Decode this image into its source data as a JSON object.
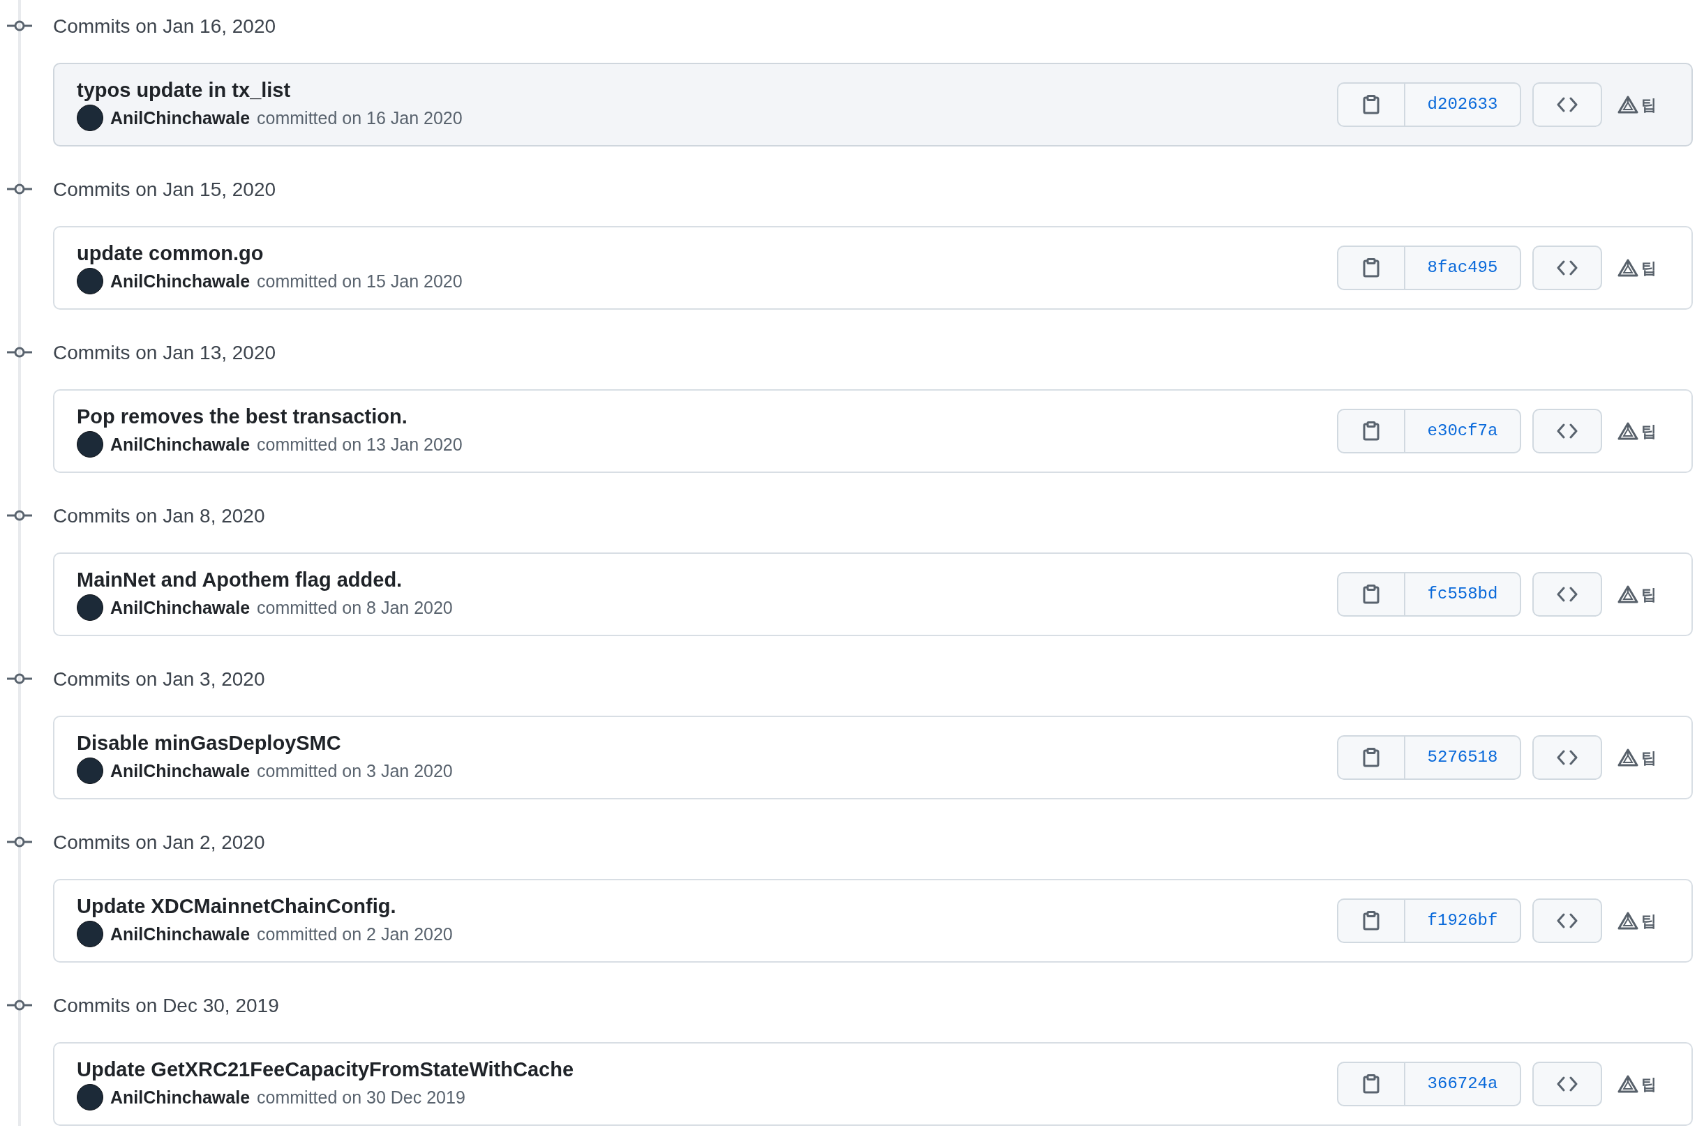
{
  "groups": [
    {
      "heading": "Commits on Jan 16, 2020",
      "commits": [
        {
          "message": "typos update in tx_list",
          "author": "AnilChinchawale",
          "meta": "committed on 16 Jan 2020",
          "sha": "d202633",
          "extra": "팁",
          "highlighted": true
        }
      ]
    },
    {
      "heading": "Commits on Jan 15, 2020",
      "commits": [
        {
          "message": "update common.go",
          "author": "AnilChinchawale",
          "meta": "committed on 15 Jan 2020",
          "sha": "8fac495",
          "extra": "팁",
          "highlighted": false
        }
      ]
    },
    {
      "heading": "Commits on Jan 13, 2020",
      "commits": [
        {
          "message": "Pop removes the best transaction.",
          "author": "AnilChinchawale",
          "meta": "committed on 13 Jan 2020",
          "sha": "e30cf7a",
          "extra": "팁",
          "highlighted": false
        }
      ]
    },
    {
      "heading": "Commits on Jan 8, 2020",
      "commits": [
        {
          "message": "MainNet and Apothem flag added.",
          "author": "AnilChinchawale",
          "meta": "committed on 8 Jan 2020",
          "sha": "fc558bd",
          "extra": "팁",
          "highlighted": false
        }
      ]
    },
    {
      "heading": "Commits on Jan 3, 2020",
      "commits": [
        {
          "message": "Disable minGasDeploySMC",
          "author": "AnilChinchawale",
          "meta": "committed on 3 Jan 2020",
          "sha": "5276518",
          "extra": "팁",
          "highlighted": false
        }
      ]
    },
    {
      "heading": "Commits on Jan 2, 2020",
      "commits": [
        {
          "message": "Update XDCMainnetChainConfig.",
          "author": "AnilChinchawale",
          "meta": "committed on 2 Jan 2020",
          "sha": "f1926bf",
          "extra": "팁",
          "highlighted": false
        }
      ]
    },
    {
      "heading": "Commits on Dec 30, 2019",
      "commits": [
        {
          "message": "Update GetXRC21FeeCapacityFromStateWithCache",
          "author": "AnilChinchawale",
          "meta": "committed on 30 Dec 2019",
          "sha": "366724a",
          "extra": "팁",
          "highlighted": false
        }
      ]
    }
  ]
}
